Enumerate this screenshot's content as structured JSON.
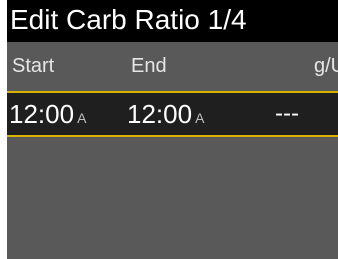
{
  "title": "Edit Carb Ratio 1/4",
  "columns": {
    "start": "Start",
    "end": "End",
    "ratio": "g/U"
  },
  "rows": [
    {
      "start_time": "12:00",
      "start_ampm": "A",
      "end_time": "12:00",
      "end_ampm": "A",
      "ratio": "---"
    }
  ],
  "colors": {
    "title_bg": "#000000",
    "screen_bg": "#595959",
    "selected_row_bg": "#1f1f1f",
    "selection_border": "#d9b300"
  }
}
